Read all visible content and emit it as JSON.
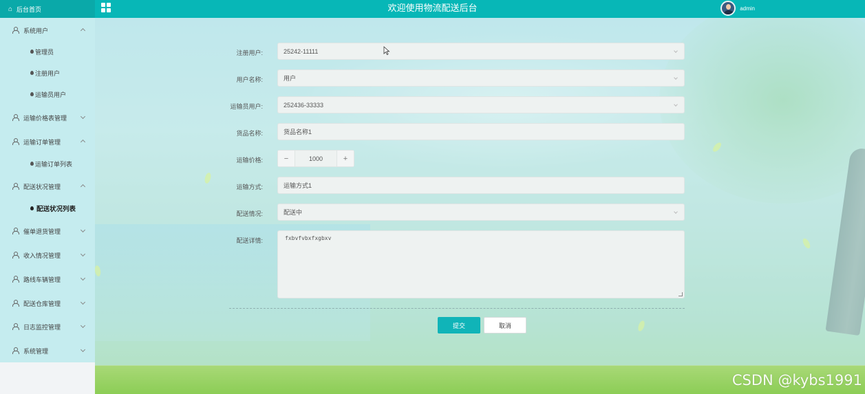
{
  "header": {
    "brand": "后台首页",
    "title": "欢迎使用物流配送后台",
    "username": "admin",
    "accent": "#07b7b7"
  },
  "sidebar": {
    "groups": [
      {
        "label": "系统用户",
        "expanded": true,
        "children": [
          "管理员",
          "注册用户",
          "运输员用户"
        ]
      },
      {
        "label": "运输价格表管理",
        "expanded": false,
        "children": []
      },
      {
        "label": "运输订单管理",
        "expanded": true,
        "children": [
          "运输订单列表"
        ]
      },
      {
        "label": "配送状况管理",
        "expanded": true,
        "children": [
          "配送状况列表"
        ]
      },
      {
        "label": "催单退货管理",
        "expanded": false,
        "children": []
      },
      {
        "label": "收入情况管理",
        "expanded": false,
        "children": []
      },
      {
        "label": "路线车辆管理",
        "expanded": false,
        "children": []
      },
      {
        "label": "配送仓库管理",
        "expanded": false,
        "children": []
      },
      {
        "label": "日志监控管理",
        "expanded": false,
        "children": []
      },
      {
        "label": "系统管理",
        "expanded": false,
        "children": []
      }
    ],
    "active_item": "配送状况列表"
  },
  "form": {
    "registered_user": {
      "label": "注册用户:",
      "value": "25242-11111"
    },
    "user_name": {
      "label": "用户名称:",
      "value": "用户"
    },
    "transporter": {
      "label": "运输员用户:",
      "value": "252436-33333"
    },
    "goods_name": {
      "label": "货品名称:",
      "value": "货品名称1"
    },
    "price": {
      "label": "运输价格:",
      "value": "1000",
      "minus": "−",
      "plus": "+"
    },
    "method": {
      "label": "运输方式:",
      "value": "运输方式1"
    },
    "status": {
      "label": "配送情况:",
      "value": "配送中"
    },
    "detail": {
      "label": "配送详情:",
      "value": "fxbvfvbxfxgbxv"
    },
    "submit_label": "提交",
    "cancel_label": "取消"
  },
  "watermark": "CSDN @kybs1991"
}
